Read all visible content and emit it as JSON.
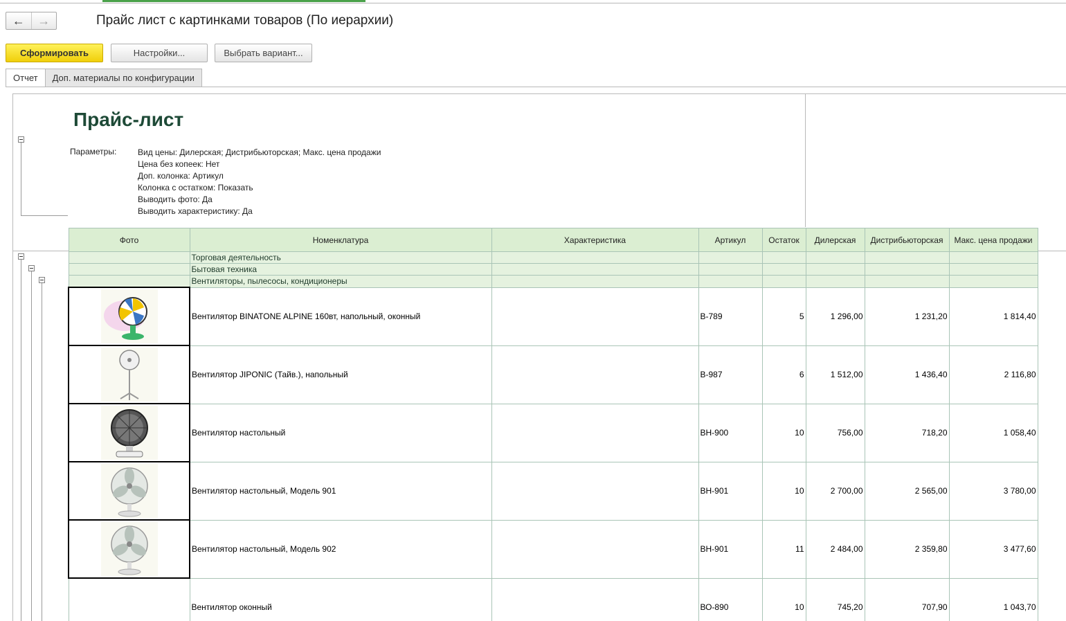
{
  "window": {
    "title": "Прайс лист с картинками товаров (По иерархии)",
    "nav_back": "←",
    "nav_forward": "→"
  },
  "toolbar": {
    "generate_label": "Сформировать",
    "settings_label": "Настройки...",
    "variant_label": "Выбрать вариант..."
  },
  "tabs": [
    {
      "label": "Отчет",
      "active": true
    },
    {
      "label": "Доп. материалы по конфигурации",
      "active": false
    }
  ],
  "report": {
    "title": "Прайс-лист",
    "params_label": "Параметры:",
    "params": [
      "Вид цены: Дилерская; Дистрибьюторская; Макс. цена продажи",
      "Цена без копеек: Нет",
      "Доп. колонка: Артикул",
      "Колонка с остатком: Показать",
      "Выводить фото: Да",
      "Выводить характеристику: Да"
    ],
    "columns": [
      "Фото",
      "Номенклатура",
      "Характеристика",
      "Артикул",
      "Остаток",
      "Дилерская",
      "Дистрибьюторская",
      "Макс. цена продажи"
    ],
    "groups": [
      "Торговая деятельность",
      "Бытовая техника",
      "Вентиляторы, пылесосы, кондиционеры"
    ],
    "rows": [
      {
        "photo": "fan-colorful-icon",
        "name": "Вентилятор BINATONE ALPINE 160вт, напольный, оконный",
        "characteristic": "",
        "article": "В-789",
        "stock": "5",
        "dealer": "1 296,00",
        "distributor": "1 231,20",
        "max_price": "1 814,40"
      },
      {
        "photo": "fan-floor-icon",
        "name": "Вентилятор JIPONIC (Тайв.), напольный",
        "characteristic": "",
        "article": "В-987",
        "stock": "6",
        "dealer": "1 512,00",
        "distributor": "1 436,40",
        "max_price": "2 116,80"
      },
      {
        "photo": "fan-desk-dark-icon",
        "name": "Вентилятор настольный",
        "characteristic": "",
        "article": "ВН-900",
        "stock": "10",
        "dealer": "756,00",
        "distributor": "718,20",
        "max_price": "1 058,40"
      },
      {
        "photo": "fan-desk-icon",
        "name": "Вентилятор настольный, Модель 901",
        "characteristic": "",
        "article": "ВН-901",
        "stock": "10",
        "dealer": "2 700,00",
        "distributor": "2 565,00",
        "max_price": "3 780,00"
      },
      {
        "photo": "fan-desk-icon",
        "name": "Вентилятор настольный, Модель 902",
        "characteristic": "",
        "article": "ВН-901",
        "stock": "11",
        "dealer": "2 484,00",
        "distributor": "2 359,80",
        "max_price": "3 477,60"
      },
      {
        "photo": "",
        "name": "Вентилятор оконный",
        "characteristic": "",
        "article": "ВО-890",
        "stock": "10",
        "dealer": "745,20",
        "distributor": "707,90",
        "max_price": "1 043,70"
      }
    ]
  },
  "colors": {
    "header_bg": "#dbeed2",
    "group_bg": "#e5f2df",
    "title_color": "#1e4a37",
    "primary_button": "#f0cf0a",
    "active_tab_strip": "#4aa14a"
  }
}
